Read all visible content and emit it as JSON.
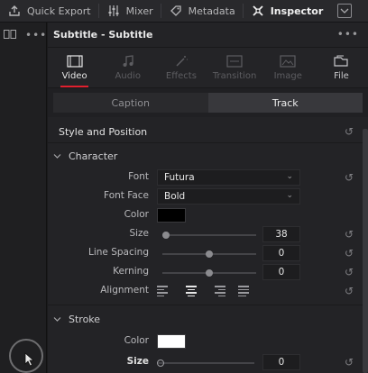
{
  "toolbar": {
    "items": [
      {
        "label": "Quick Export",
        "icon": "quick-export-icon"
      },
      {
        "label": "Mixer",
        "icon": "mixer-icon"
      },
      {
        "label": "Metadata",
        "icon": "metadata-icon"
      },
      {
        "label": "Inspector",
        "icon": "inspector-icon"
      }
    ]
  },
  "panel": {
    "title": "Subtitle - Subtitle",
    "tabs": [
      {
        "label": "Video",
        "state": "active"
      },
      {
        "label": "Audio",
        "state": "disabled"
      },
      {
        "label": "Effects",
        "state": "disabled"
      },
      {
        "label": "Transition",
        "state": "disabled"
      },
      {
        "label": "Image",
        "state": "disabled"
      },
      {
        "label": "File",
        "state": "normal"
      }
    ],
    "segments": {
      "caption": "Caption",
      "track": "Track",
      "selected": "Track"
    }
  },
  "style": {
    "section_title": "Style and Position",
    "character": {
      "title": "Character",
      "font_label": "Font",
      "font_value": "Futura",
      "font_face_label": "Font Face",
      "font_face_value": "Bold",
      "color_label": "Color",
      "color_value": "#000000",
      "size_label": "Size",
      "size_value": "38",
      "line_spacing_label": "Line Spacing",
      "line_spacing_value": "0",
      "kerning_label": "Kerning",
      "kerning_value": "0",
      "alignment_label": "Alignment",
      "alignment_options": [
        "left",
        "center",
        "right",
        "justify"
      ],
      "alignment_selected": "center"
    },
    "stroke": {
      "title": "Stroke",
      "color_label": "Color",
      "color_value": "#ffffff",
      "size_label": "Size",
      "size_value": "0"
    }
  },
  "colors": {
    "accent": "#e0202e"
  }
}
